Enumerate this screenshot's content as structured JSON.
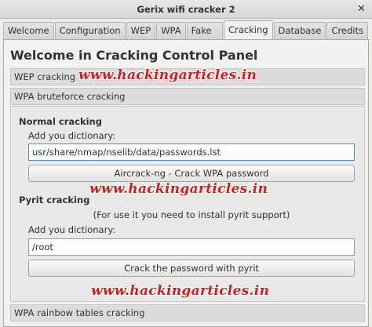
{
  "window": {
    "title": "Gerix wifi cracker 2",
    "close_glyph": "✕"
  },
  "tabs": [
    {
      "label": "Welcome",
      "active": false
    },
    {
      "label": "Configuration",
      "active": false
    },
    {
      "label": "WEP",
      "active": false
    },
    {
      "label": "WPA",
      "active": false
    },
    {
      "label": "Fake AP",
      "active": false
    },
    {
      "label": "Cracking",
      "active": true
    },
    {
      "label": "Database",
      "active": false
    },
    {
      "label": "Credits",
      "active": false
    }
  ],
  "main": {
    "heading": "Welcome in Cracking Control Panel",
    "sections": {
      "wep": "WEP cracking",
      "wpa_bruteforce": "WPA bruteforce cracking",
      "wpa_rainbow": "WPA rainbow tables cracking"
    },
    "normal": {
      "title": "Normal cracking",
      "dict_label": "Add you dictionary:",
      "dict_value": "usr/share/nmap/nselib/data/passwords.lst",
      "button": "Aircrack-ng - Crack WPA password"
    },
    "pyrit": {
      "title": "Pyrit cracking",
      "note": "(For use it you need to install pyrit support)",
      "dict_label": "Add you dictionary:",
      "dict_value": "/root",
      "button": "Crack the password with pyrit"
    }
  },
  "watermark": "www.hackingarticles.in",
  "colors": {
    "watermark": "#e01818",
    "focus": "#4a90d9"
  }
}
